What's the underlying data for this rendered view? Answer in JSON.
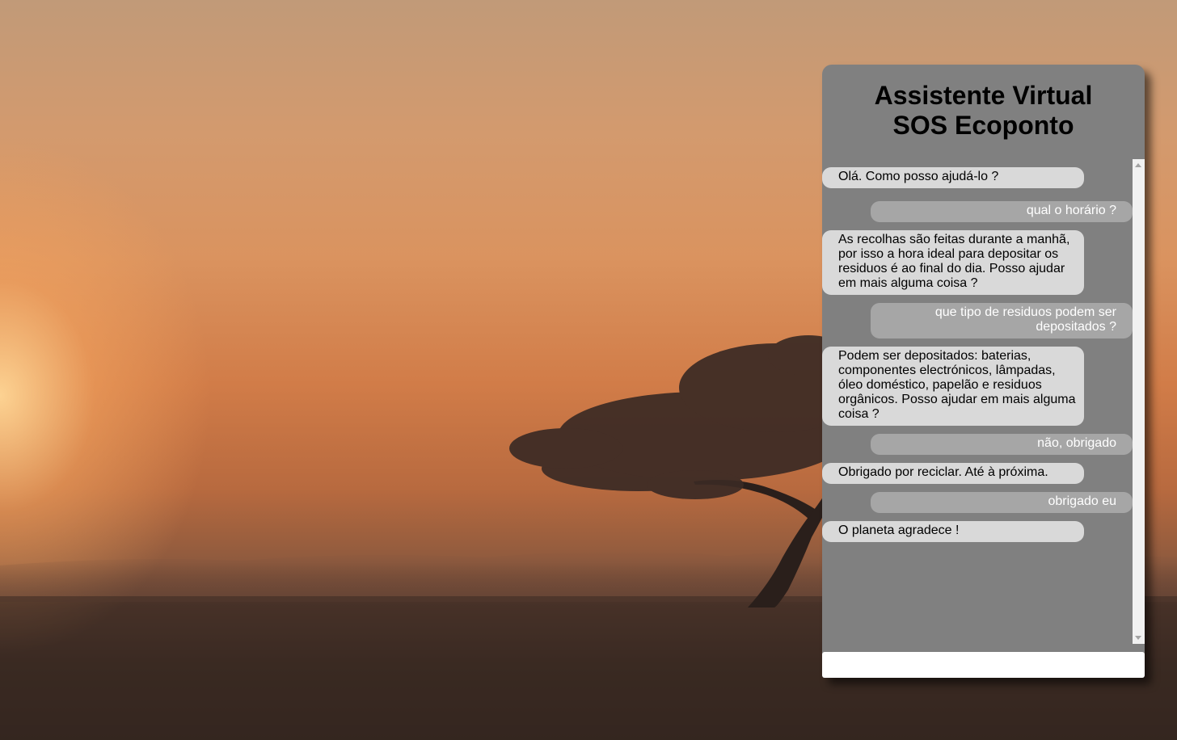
{
  "chat": {
    "title_line1": "Assistente Virtual",
    "title_line2": "SOS Ecoponto",
    "messages": [
      {
        "from": "bot",
        "text": "Olá. Como posso ajudá-lo ?"
      },
      {
        "from": "user",
        "text": "qual o horário ?"
      },
      {
        "from": "bot",
        "text": "As recolhas são feitas durante a manhã, por isso a hora ideal para depositar os residuos é ao final do dia. Posso ajudar em mais alguma coisa ?"
      },
      {
        "from": "user",
        "text": "que tipo de residuos podem ser depositados ?"
      },
      {
        "from": "bot",
        "text": "Podem ser depositados: baterias, componentes electrónicos, lâmpadas, óleo doméstico, papelão e residuos orgânicos. Posso ajudar em mais alguma coisa ?"
      },
      {
        "from": "user",
        "text": "não, obrigado"
      },
      {
        "from": "bot",
        "text": "Obrigado por reciclar. Até à próxima."
      },
      {
        "from": "user",
        "text": "obrigado eu"
      },
      {
        "from": "bot",
        "text": "O planeta agradece !"
      }
    ],
    "input": {
      "value": "",
      "placeholder": ""
    }
  },
  "colors": {
    "panel": "#808080",
    "bot_bubble": "#d9d9d9",
    "user_bubble": "#a6a6a6"
  },
  "icons": {
    "scroll_up": "scroll-up-arrow-icon",
    "scroll_down": "scroll-down-arrow-icon"
  }
}
